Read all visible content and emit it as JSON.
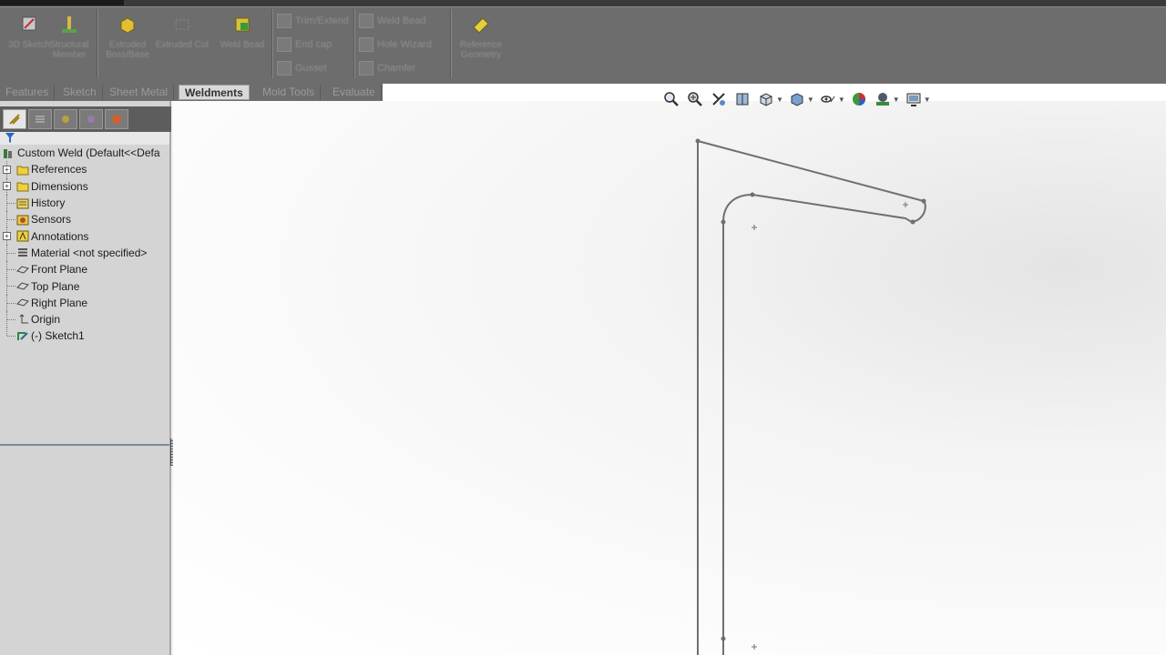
{
  "app": {
    "accent": "#2c64c8"
  },
  "command_manager": {
    "buttons": [
      {
        "label": "3D Sketch",
        "icon": "3d-sketch-icon"
      },
      {
        "label": "Structural Member",
        "icon": "structural-member-icon"
      },
      {
        "label": "Extruded Boss/Base",
        "icon": "extruded-boss-icon"
      },
      {
        "label": "Extruded Cut",
        "icon": "extruded-cut-icon"
      },
      {
        "label": "Weld Bead",
        "icon": "weld-bead-icon"
      },
      {
        "label": "Reference Geometry",
        "icon": "reference-geometry-icon"
      }
    ],
    "small_buttons": [
      {
        "label": "Trim/Extend",
        "icon": "trim-extend-icon"
      },
      {
        "label": "End cap",
        "icon": "end-cap-icon"
      },
      {
        "label": "Gusset",
        "icon": "gusset-icon"
      },
      {
        "label": "Weld Bead",
        "icon": "weld-bead-icon"
      },
      {
        "label": "Hole Wizard",
        "icon": "hole-wizard-icon"
      },
      {
        "label": "Chamfer",
        "icon": "chamfer-icon"
      }
    ]
  },
  "tabs": [
    {
      "label": "Features",
      "active": false
    },
    {
      "label": "Sketch",
      "active": false
    },
    {
      "label": "Sheet Metal",
      "active": false
    },
    {
      "label": "Weldments",
      "active": true
    },
    {
      "label": "Mold Tools",
      "active": false
    },
    {
      "label": "Evaluate",
      "active": false
    }
  ],
  "feature_tree": {
    "root": {
      "label": "Custom Weld  (Default<<Defa",
      "icon": "part-icon"
    },
    "items": [
      {
        "label": "References",
        "icon": "folder-icon",
        "expandable": true
      },
      {
        "label": "Dimensions",
        "icon": "folder-icon",
        "expandable": true
      },
      {
        "label": "History",
        "icon": "history-icon",
        "expandable": false
      },
      {
        "label": "Sensors",
        "icon": "sensors-icon",
        "expandable": false
      },
      {
        "label": "Annotations",
        "icon": "annotations-icon",
        "expandable": true
      },
      {
        "label": "Material <not specified>",
        "icon": "material-icon",
        "expandable": false
      },
      {
        "label": "Front Plane",
        "icon": "plane-icon",
        "expandable": false
      },
      {
        "label": "Top Plane",
        "icon": "plane-icon",
        "expandable": false
      },
      {
        "label": "Right Plane",
        "icon": "plane-icon",
        "expandable": false
      },
      {
        "label": "Origin",
        "icon": "origin-icon",
        "expandable": false
      },
      {
        "label": "(-) Sketch1",
        "icon": "sketch-icon",
        "expandable": false
      }
    ]
  },
  "heads_up_toolbar": [
    "zoom-to-fit-icon",
    "zoom-to-area-icon",
    "previous-view-icon",
    "section-view-icon",
    "view-orientation-icon",
    "display-style-icon",
    "hide-show-items-icon",
    "edit-appearance-icon",
    "apply-scene-icon",
    "view-settings-icon"
  ]
}
